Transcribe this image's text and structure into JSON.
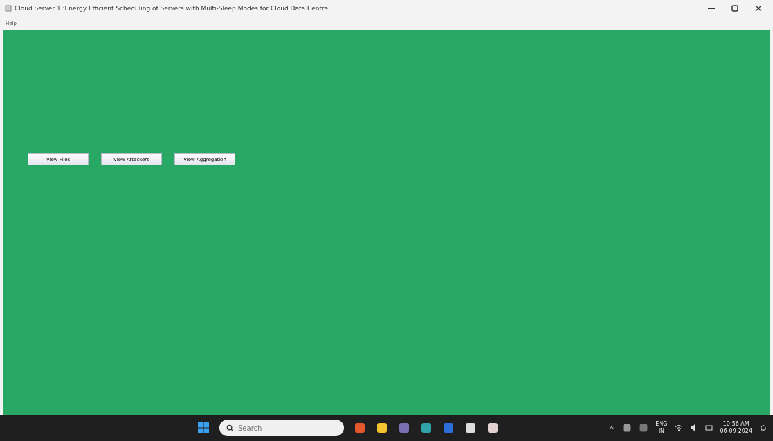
{
  "window": {
    "title": "Cloud Server 1 :Energy Efficient Scheduling of Servers with Multi-Sleep Modes for Cloud Data Centre"
  },
  "menu": [
    "Help"
  ],
  "buttons": [
    "View Files",
    "View Attackers",
    "View Aggregation"
  ],
  "taskbar": {
    "search": {
      "placeholder": "Search"
    },
    "tray": {
      "language": "ENG",
      "region": "IN",
      "time": "10:56 AM",
      "date": "06-09-2024"
    }
  }
}
